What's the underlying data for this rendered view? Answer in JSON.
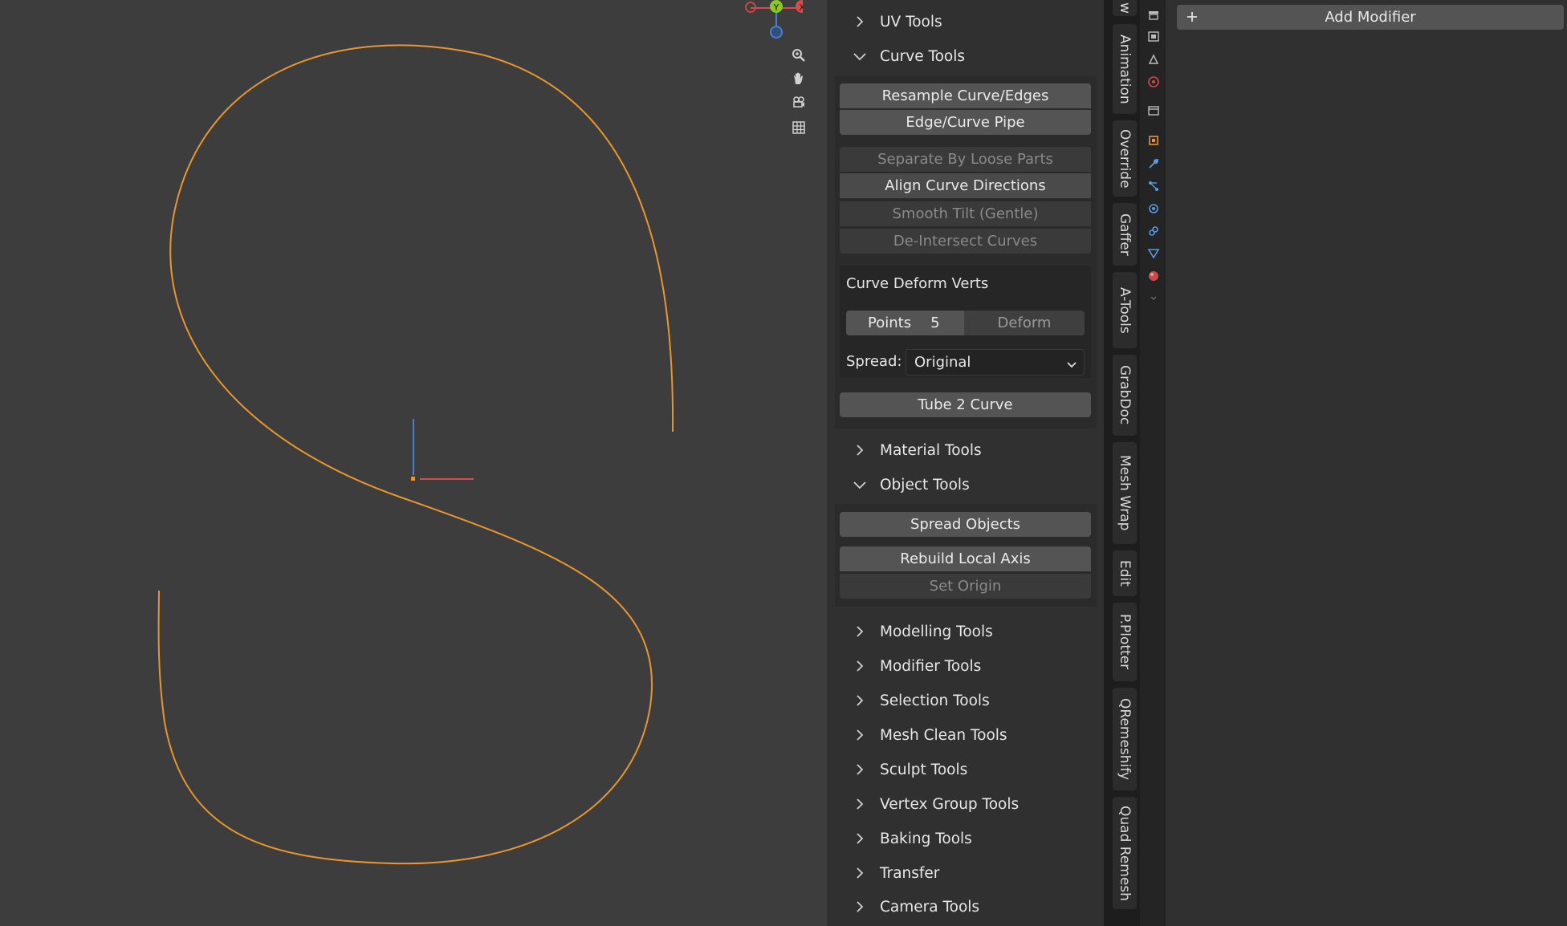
{
  "npanel": {
    "sections_top": [
      {
        "label": "UV Tools",
        "expanded": false
      },
      {
        "label": "Curve Tools",
        "expanded": true
      }
    ],
    "curve_tools": {
      "resample": "Resample Curve/Edges",
      "pipe": "Edge/Curve Pipe",
      "separate": "Separate By Loose Parts",
      "align": "Align Curve Directions",
      "smooth": "Smooth Tilt (Gentle)",
      "deintersect": "De-Intersect Curves",
      "deform_title": "Curve Deform Verts",
      "points_label": "Points",
      "points_value": "5",
      "deform_label": "Deform",
      "spread_label": "Spread:",
      "spread_value": "Original",
      "tube": "Tube 2 Curve"
    },
    "material_tools": "Material Tools",
    "object_tools": {
      "label": "Object Tools",
      "spread": "Spread Objects",
      "rebuild": "Rebuild Local Axis",
      "set_origin": "Set Origin"
    },
    "sections_bottom": [
      "Modelling Tools",
      "Modifier Tools",
      "Selection Tools",
      "Mesh Clean Tools",
      "Sculpt Tools",
      "Vertex Group Tools",
      "Baking Tools",
      "Transfer",
      "Camera Tools"
    ]
  },
  "vertical_tabs": [
    "Animation",
    "Override",
    "Gaffer",
    "A-Tools",
    "GrabDoc",
    "Mesh Wrap",
    "Edit",
    "P.Plotter",
    "QRemeshify",
    "Quad Remesh"
  ],
  "vertical_tab_partial": "w",
  "gizmo": {
    "y_label": "Y",
    "x_label": "X"
  },
  "properties": {
    "add_modifier": "Add Modifier"
  },
  "colors": {
    "curve": "#e8962e",
    "axis_x": "#d94a4a",
    "axis_y": "#8ac926",
    "axis_z": "#4a7fd0"
  }
}
